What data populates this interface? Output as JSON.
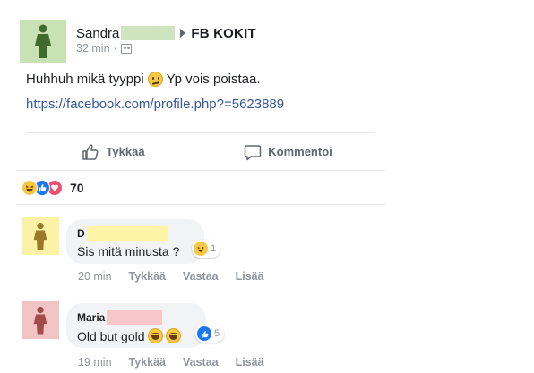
{
  "post": {
    "author": "Sandra",
    "group": "FB KOKIT",
    "time": "32 min",
    "separator": "·",
    "text_part1": "Huhhuh mikä tyyppi",
    "text_part2": "Yp vois poistaa.",
    "link": "https://facebook.com/profile.php?=5623889",
    "avatar_color": "#c8e2b4",
    "redaction_color": "#cde4be"
  },
  "actions": {
    "like_label": "Tykkää",
    "comment_label": "Kommentoi"
  },
  "reactions": {
    "icons": [
      "haha-reaction-icon",
      "like-reaction-icon",
      "love-reaction-icon"
    ],
    "count": "70"
  },
  "comments": [
    {
      "author": "D",
      "text": "Sis mitä minusta ?",
      "reaction_count": "1",
      "time": "20 min",
      "like_label": "Tykkää",
      "reply_label": "Vastaa",
      "more_label": "Lisää",
      "avatar_color": "#fbf2a6",
      "redaction_color": "#fdf4a8"
    },
    {
      "author": "Maria",
      "text": "Old but gold",
      "reaction_count": "5",
      "time": "19 min",
      "like_label": "Tykkää",
      "reply_label": "Vastaa",
      "more_label": "Lisää",
      "avatar_color": "#f2c4c4",
      "redaction_color": "#f7c6c8"
    }
  ]
}
